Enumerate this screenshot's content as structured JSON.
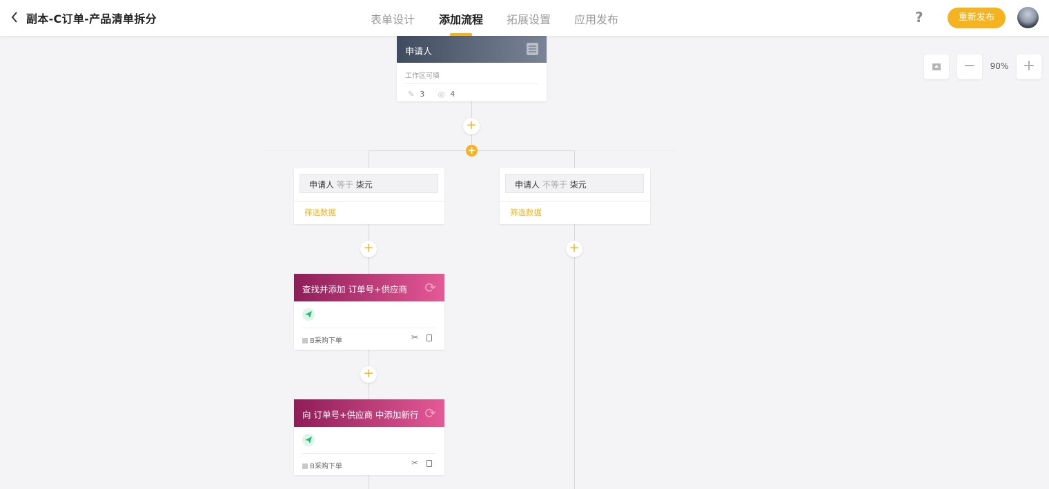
{
  "header": {
    "back_icon": "chevron-left-icon",
    "title": "副本-C订单-产品清单拆分",
    "tabs": [
      {
        "label": "表单设计",
        "active": false
      },
      {
        "label": "添加流程",
        "active": true
      },
      {
        "label": "拓展设置",
        "active": false
      },
      {
        "label": "应用发布",
        "active": false
      }
    ],
    "help_label": "?",
    "republish_label": "重新发布",
    "accent": "#f5b320"
  },
  "zoom": {
    "level": "90%",
    "minus_label": "−",
    "plus_label": "+"
  },
  "flow": {
    "start_node": {
      "title": "申请人",
      "subtitle": "工作区可填",
      "edit_count": "3",
      "view_count": "4"
    },
    "branch_add_label": "+",
    "add_label": "+",
    "branches": [
      {
        "field": "申请人",
        "operator": "等于",
        "value": "柒元",
        "filter_label": "筛选数据"
      },
      {
        "field": "申请人",
        "operator": "不等于",
        "value": "柒元",
        "filter_label": "筛选数据"
      }
    ],
    "actions": [
      {
        "title": "查找并添加 订单号+供应商",
        "footer": "B采购下单",
        "color_from": "#8e1d58",
        "color_to": "#e55996"
      },
      {
        "title": "向 订单号+供应商 中添加新行",
        "footer": "B采购下单",
        "color_from": "#8e1d58",
        "color_to": "#e55996"
      }
    ]
  }
}
